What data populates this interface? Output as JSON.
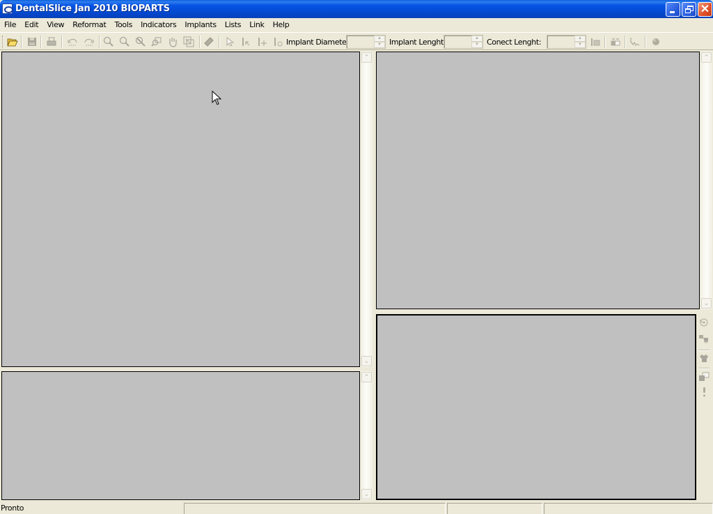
{
  "window": {
    "title": "DentalSlice Jan 2010 BIOPARTS",
    "controls": [
      "minimize",
      "restore",
      "close"
    ]
  },
  "menu": [
    "File",
    "Edit",
    "View",
    "Reformat",
    "Tools",
    "Indicators",
    "Implants",
    "Lists",
    "Link",
    "Help"
  ],
  "toolbar": {
    "buttons": [
      {
        "name": "open",
        "icon": "folder-open-icon",
        "enabled": true
      },
      {
        "name": "save",
        "icon": "floppy-disk-icon",
        "enabled": false
      },
      {
        "name": "print",
        "icon": "printer-icon",
        "enabled": false
      },
      {
        "name": "undo",
        "icon": "undo-icon",
        "enabled": false
      },
      {
        "name": "redo",
        "icon": "redo-icon",
        "enabled": false
      },
      {
        "name": "zoom-in",
        "icon": "zoom-in-icon",
        "enabled": false
      },
      {
        "name": "zoom-out",
        "icon": "zoom-out-icon",
        "enabled": false
      },
      {
        "name": "zoom-reset",
        "icon": "zoom-reset-icon",
        "enabled": false
      },
      {
        "name": "zoom-window",
        "icon": "zoom-window-icon",
        "enabled": false
      },
      {
        "name": "pan",
        "icon": "hand-pan-icon",
        "enabled": false
      },
      {
        "name": "fit",
        "icon": "fit-window-icon",
        "enabled": false
      },
      {
        "name": "measure",
        "icon": "ruler-icon",
        "enabled": false
      },
      {
        "name": "select",
        "icon": "arrow-pointer-icon",
        "enabled": false
      },
      {
        "name": "select-line",
        "icon": "line-select-icon",
        "enabled": false
      },
      {
        "name": "move-line",
        "icon": "line-move-icon",
        "enabled": false
      },
      {
        "name": "rotate-line",
        "icon": "line-rotate-icon",
        "enabled": false
      }
    ],
    "implant_diameter": {
      "label": "Implant Diameter:",
      "value": ""
    },
    "implant_length": {
      "label": "Implant Lenght:",
      "value": ""
    },
    "connect_length": {
      "label": "Conect Lenght:",
      "value": ""
    },
    "tail_buttons": [
      {
        "name": "density",
        "icon": "density-bar-icon",
        "enabled": false
      },
      {
        "name": "implant-view",
        "icon": "implant-view-icon",
        "enabled": false
      },
      {
        "name": "nerve-trace",
        "icon": "nerve-trace-icon",
        "enabled": false
      },
      {
        "name": "tooth",
        "icon": "tooth-icon",
        "enabled": false
      }
    ]
  },
  "side_toolbar": [
    {
      "name": "rotate",
      "icon": "rotate-icon"
    },
    {
      "name": "teeth",
      "icon": "teeth-icon"
    },
    {
      "name": "hand",
      "icon": "hand-icon"
    },
    {
      "name": "window-level",
      "icon": "window-level-icon"
    },
    {
      "name": "info",
      "icon": "exclamation-icon"
    }
  ],
  "statusbar": {
    "text": "Pronto",
    "panels": [
      "",
      "",
      ""
    ]
  },
  "colors": {
    "titlebar": "#0554e3",
    "viewport": "#c0c0c0",
    "chrome": "#ece9d8",
    "close_button": "#e0502a"
  }
}
